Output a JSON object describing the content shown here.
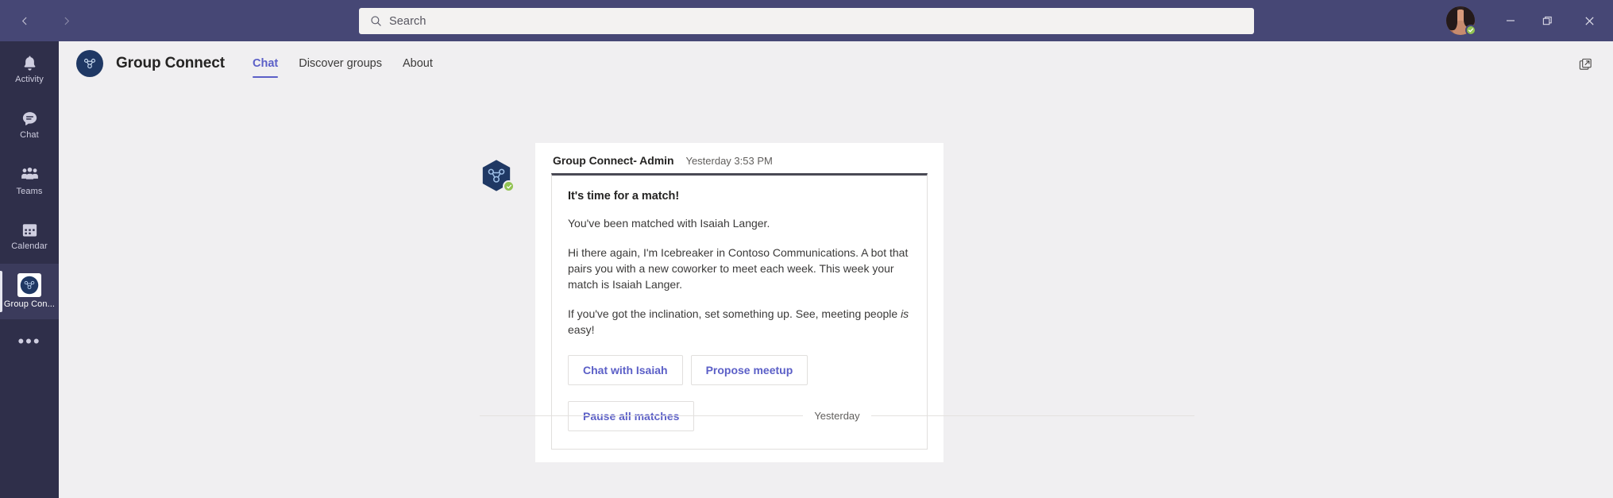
{
  "window": {
    "back_label": "Back",
    "forward_label": "Forward",
    "minimize_label": "Minimize",
    "restore_label": "Restore",
    "close_label": "Close"
  },
  "search": {
    "placeholder": "Search",
    "value": "",
    "icon": "search-icon"
  },
  "user": {
    "presence": "available",
    "presence_color": "#92c353"
  },
  "rail": {
    "items": [
      {
        "label": "Activity",
        "icon": "bell-icon",
        "active": false
      },
      {
        "label": "Chat",
        "icon": "chat-bubble-icon",
        "active": false
      },
      {
        "label": "Teams",
        "icon": "people-icon",
        "active": false
      },
      {
        "label": "Calendar",
        "icon": "calendar-icon",
        "active": false
      },
      {
        "label": "Group Con...",
        "icon": "group-connect-icon",
        "active": true
      }
    ],
    "more_label": "•••"
  },
  "app": {
    "title": "Group Connect",
    "icon": "group-connect-app-icon",
    "tabs": [
      {
        "label": "Chat",
        "active": true
      },
      {
        "label": "Discover groups",
        "active": false
      },
      {
        "label": "About",
        "active": false
      }
    ],
    "popout_icon": "open-in-new-window-icon"
  },
  "message": {
    "sender": "Group Connect- Admin",
    "timestamp": "Yesterday 3:53 PM",
    "avatar_icon": "group-connect-bot-avatar",
    "presence": "available"
  },
  "card": {
    "title": "It's time for a match!",
    "paragraph1": "You've been matched with Isaiah Langer.",
    "paragraph2": "Hi there again, I'm Icebreaker in Contoso Communications. A bot that pairs you with a new coworker to meet each week. This week your match is Isaiah Langer.",
    "paragraph3_pre": "If you've got the inclination, set something up. See, meeting people ",
    "paragraph3_em": "is",
    "paragraph3_post": " easy!",
    "actions": [
      {
        "label": "Chat with Isaiah"
      },
      {
        "label": "Propose meetup"
      },
      {
        "label": "Pause all matches"
      }
    ],
    "accent_color": "#4a4a55"
  },
  "divider": {
    "label": "Yesterday"
  },
  "theme": {
    "titlebar": "#464775",
    "rail": "#2f2f4a",
    "accent": "#5b5fc7",
    "canvas": "#f0eff1"
  }
}
